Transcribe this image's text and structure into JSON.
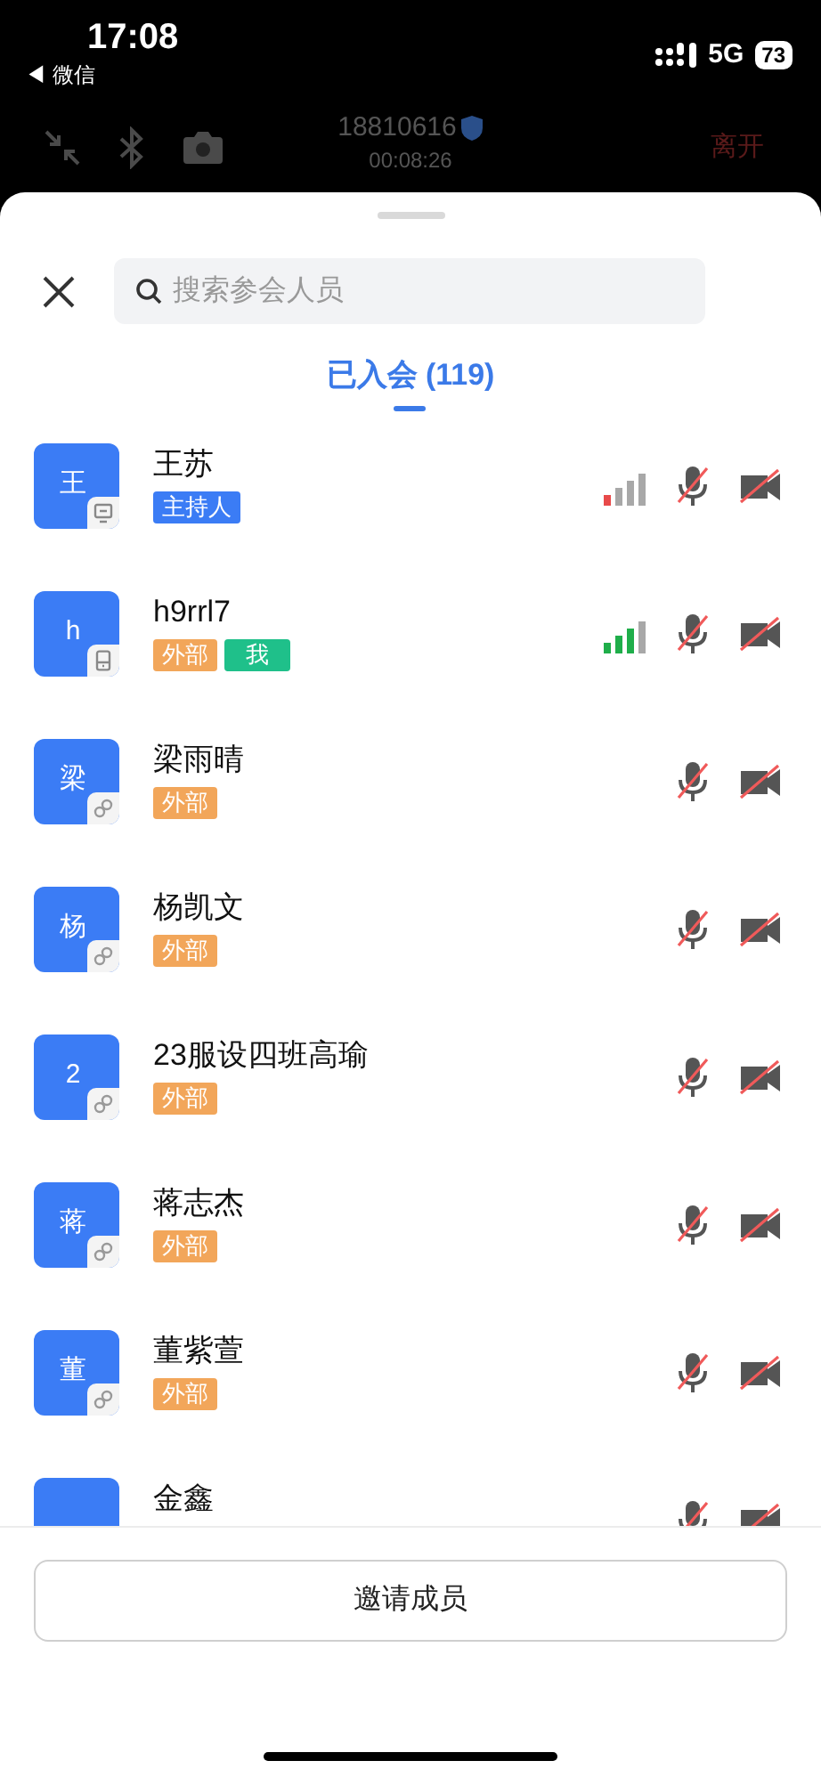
{
  "status_bar": {
    "time": "17:08",
    "back_app": "◀ 微信",
    "network": "5G",
    "battery": "73"
  },
  "call_bar": {
    "meeting_id": "18810616",
    "duration": "00:08:26",
    "leave": "离开"
  },
  "search": {
    "placeholder": "搜索参会人员"
  },
  "tab": {
    "label": "已入会 (119)",
    "selected": true
  },
  "members": [
    {
      "avatar": "王",
      "name": "王苏",
      "device": {
        "kind": "desktop"
      },
      "tags": [
        {
          "kind": "host",
          "label": "主持人"
        }
      ],
      "signal": {
        "kind": "poor"
      },
      "muted": true,
      "camera_off": true
    },
    {
      "avatar": "h",
      "name": "h9rrl7",
      "device": {
        "kind": "mobile"
      },
      "tags": [
        {
          "kind": "external",
          "label": "外部"
        },
        {
          "kind": "me",
          "label": "我"
        }
      ],
      "signal": {
        "kind": "good"
      },
      "muted": true,
      "camera_off": true
    },
    {
      "avatar": "梁",
      "name": "梁雨晴",
      "device": {
        "kind": "link"
      },
      "tags": [
        {
          "kind": "external",
          "label": "外部"
        }
      ],
      "muted": true,
      "camera_off": true
    },
    {
      "avatar": "杨",
      "name": "杨凯文",
      "device": {
        "kind": "link"
      },
      "tags": [
        {
          "kind": "external",
          "label": "外部"
        }
      ],
      "muted": true,
      "camera_off": true
    },
    {
      "avatar": "2",
      "name": "23服设四班高瑜",
      "device": {
        "kind": "link"
      },
      "tags": [
        {
          "kind": "external",
          "label": "外部"
        }
      ],
      "muted": true,
      "camera_off": true
    },
    {
      "avatar": "蒋",
      "name": "蒋志杰",
      "device": {
        "kind": "link"
      },
      "tags": [
        {
          "kind": "external",
          "label": "外部"
        }
      ],
      "muted": true,
      "camera_off": true
    },
    {
      "avatar": "董",
      "name": "董紫萱",
      "device": {
        "kind": "link"
      },
      "tags": [
        {
          "kind": "external",
          "label": "外部"
        }
      ],
      "muted": true,
      "camera_off": true
    },
    {
      "name": "金鑫",
      "muted": true,
      "camera_off": true
    }
  ],
  "invite_button": "邀请成员"
}
